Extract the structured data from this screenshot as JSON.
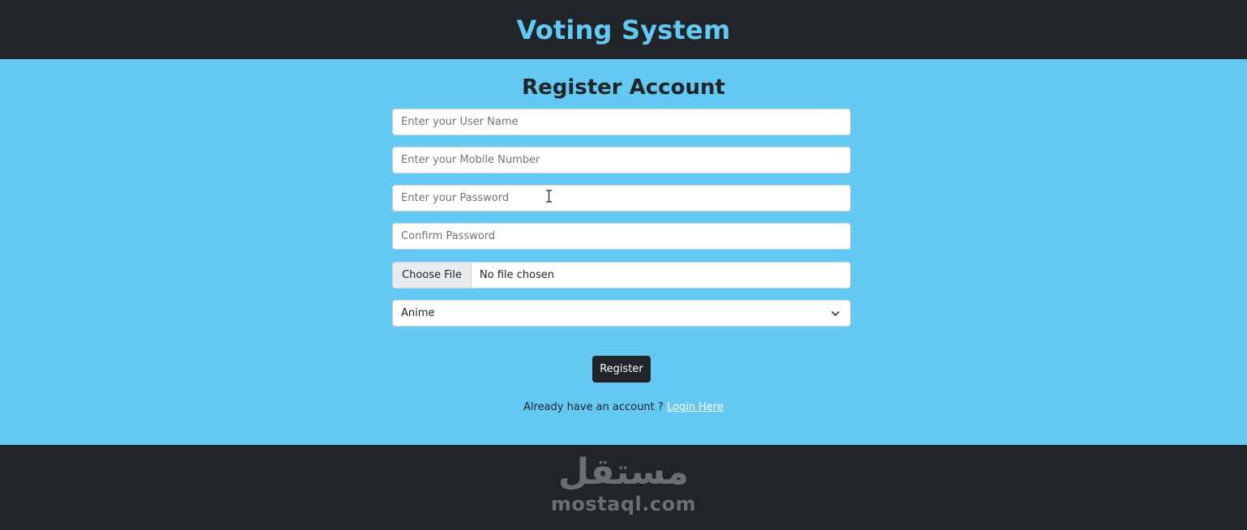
{
  "header": {
    "title": "Voting System"
  },
  "form": {
    "title": "Register Account",
    "username_placeholder": "Enter your User Name",
    "mobile_placeholder": "Enter your Mobile Number",
    "password_placeholder": "Enter your Password",
    "confirm_placeholder": "Confirm Password",
    "file_button_label": "Choose File",
    "file_status": "No file chosen",
    "role_selected": "Anime",
    "register_label": "Register",
    "login_prompt": "Already have an account ?",
    "login_link": "Login Here"
  },
  "watermark": {
    "arabic": "مستقل",
    "latin": "mostaql.com"
  },
  "colors": {
    "header_bg": "#212529",
    "title_color": "#63c8f2",
    "main_bg": "#63c8f2",
    "button_bg": "#212529"
  },
  "icons": {
    "select_arrow": "chevron-down-icon",
    "mouse_cursor": "text-cursor-icon"
  }
}
